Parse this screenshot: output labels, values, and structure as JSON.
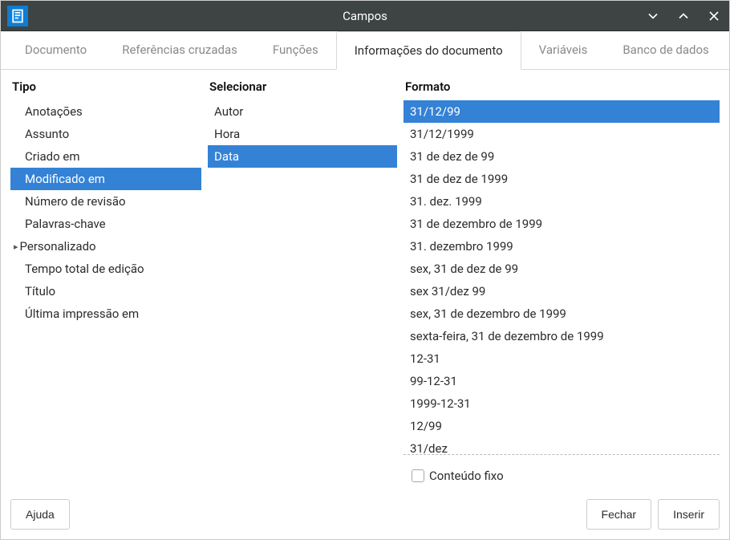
{
  "title": "Campos",
  "tabs": [
    {
      "label": "Documento",
      "active": false
    },
    {
      "label": "Referências cruzadas",
      "active": false
    },
    {
      "label": "Funções",
      "active": false
    },
    {
      "label": "Informações do documento",
      "active": true
    },
    {
      "label": "Variáveis",
      "active": false
    },
    {
      "label": "Banco de dados",
      "active": false
    }
  ],
  "panels": {
    "tipo": {
      "header": "Tipo",
      "items": [
        {
          "label": "Anotações"
        },
        {
          "label": "Assunto"
        },
        {
          "label": "Criado em"
        },
        {
          "label": "Modificado em",
          "selected": true
        },
        {
          "label": "Número de revisão"
        },
        {
          "label": "Palavras-chave"
        },
        {
          "label": "Personalizado",
          "expandable": true
        },
        {
          "label": "Tempo total de edição"
        },
        {
          "label": "Título"
        },
        {
          "label": "Última impressão em"
        }
      ]
    },
    "selecionar": {
      "header": "Selecionar",
      "items": [
        {
          "label": "Autor"
        },
        {
          "label": "Hora"
        },
        {
          "label": "Data",
          "selected": true
        }
      ]
    },
    "formato": {
      "header": "Formato",
      "items": [
        {
          "label": "31/12/99",
          "selected": true
        },
        {
          "label": "31/12/1999"
        },
        {
          "label": "31 de dez de 99"
        },
        {
          "label": "31 de dez de 1999"
        },
        {
          "label": "31. dez. 1999"
        },
        {
          "label": "31 de dezembro de 1999"
        },
        {
          "label": "31. dezembro 1999"
        },
        {
          "label": "sex, 31 de dez de 99"
        },
        {
          "label": "sex 31/dez 99"
        },
        {
          "label": "sex, 31 de dezembro de 1999"
        },
        {
          "label": "sexta-feira, 31 de dezembro de 1999"
        },
        {
          "label": "12-31"
        },
        {
          "label": "99-12-31"
        },
        {
          "label": "1999-12-31"
        },
        {
          "label": "12/99"
        },
        {
          "label": "31/dez"
        }
      ]
    }
  },
  "checkbox": {
    "label": "Conteúdo fixo",
    "checked": false
  },
  "buttons": {
    "help": "Ajuda",
    "close": "Fechar",
    "insert": "Inserir"
  }
}
